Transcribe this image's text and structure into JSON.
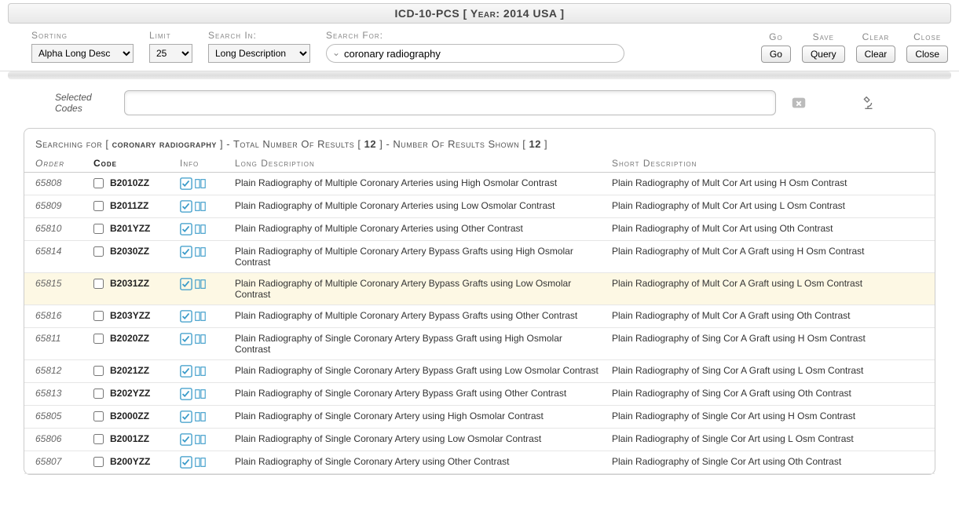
{
  "title": "ICD-10-PCS [ Year: 2014 USA ]",
  "toolbar": {
    "sorting_lbl": "Sorting",
    "sorting_val": "Alpha Long Desc",
    "limit_lbl": "Limit",
    "limit_val": "25",
    "searchin_lbl": "Search In:",
    "searchin_val": "Long Description",
    "searchfor_lbl": "Search For:",
    "searchfor_val": "coronary radiography",
    "go_lbl": "Go",
    "go_btn": "Go",
    "save_lbl": "Save",
    "save_btn": "Query",
    "clear_lbl": "Clear",
    "clear_btn": "Clear",
    "close_lbl": "Close",
    "close_btn": "Close"
  },
  "selected": {
    "label": "Selected Codes",
    "value": ""
  },
  "searchinfo": {
    "prefix": "Searching for [ ",
    "term": "coronary radiography",
    "mid1": " ] - Total Number Of Results [ ",
    "total": "12",
    "mid2": " ] - Number Of Results Shown [ ",
    "shown": "12",
    "suffix": " ]"
  },
  "headers": {
    "order": "Order",
    "code": "Code",
    "info": "Info",
    "long": "Long Description",
    "short": "Short Description"
  },
  "rows": [
    {
      "order": "65808",
      "code": "B2010ZZ",
      "long": "Plain Radiography of Multiple Coronary Arteries using High Osmolar Contrast",
      "short": "Plain Radiography of Mult Cor Art using H Osm Contrast"
    },
    {
      "order": "65809",
      "code": "B2011ZZ",
      "long": "Plain Radiography of Multiple Coronary Arteries using Low Osmolar Contrast",
      "short": "Plain Radiography of Mult Cor Art using L Osm Contrast"
    },
    {
      "order": "65810",
      "code": "B201YZZ",
      "long": "Plain Radiography of Multiple Coronary Arteries using Other Contrast",
      "short": "Plain Radiography of Mult Cor Art using Oth Contrast"
    },
    {
      "order": "65814",
      "code": "B2030ZZ",
      "long": "Plain Radiography of Multiple Coronary Artery Bypass Grafts using High Osmolar Contrast",
      "short": "Plain Radiography of Mult Cor A Graft using H Osm Contrast"
    },
    {
      "order": "65815",
      "code": "B2031ZZ",
      "long": "Plain Radiography of Multiple Coronary Artery Bypass Grafts using Low Osmolar Contrast",
      "short": "Plain Radiography of Mult Cor A Graft using L Osm Contrast",
      "hover": true
    },
    {
      "order": "65816",
      "code": "B203YZZ",
      "long": "Plain Radiography of Multiple Coronary Artery Bypass Grafts using Other Contrast",
      "short": "Plain Radiography of Mult Cor A Graft using Oth Contrast"
    },
    {
      "order": "65811",
      "code": "B2020ZZ",
      "long": "Plain Radiography of Single Coronary Artery Bypass Graft using High Osmolar Contrast",
      "short": "Plain Radiography of Sing Cor A Graft using H Osm Contrast"
    },
    {
      "order": "65812",
      "code": "B2021ZZ",
      "long": "Plain Radiography of Single Coronary Artery Bypass Graft using Low Osmolar Contrast",
      "short": "Plain Radiography of Sing Cor A Graft using L Osm Contrast"
    },
    {
      "order": "65813",
      "code": "B202YZZ",
      "long": "Plain Radiography of Single Coronary Artery Bypass Graft using Other Contrast",
      "short": "Plain Radiography of Sing Cor A Graft using Oth Contrast"
    },
    {
      "order": "65805",
      "code": "B2000ZZ",
      "long": "Plain Radiography of Single Coronary Artery using High Osmolar Contrast",
      "short": "Plain Radiography of Single Cor Art using H Osm Contrast"
    },
    {
      "order": "65806",
      "code": "B2001ZZ",
      "long": "Plain Radiography of Single Coronary Artery using Low Osmolar Contrast",
      "short": "Plain Radiography of Single Cor Art using L Osm Contrast"
    },
    {
      "order": "65807",
      "code": "B200YZZ",
      "long": "Plain Radiography of Single Coronary Artery using Other Contrast",
      "short": "Plain Radiography of Single Cor Art using Oth Contrast"
    }
  ]
}
